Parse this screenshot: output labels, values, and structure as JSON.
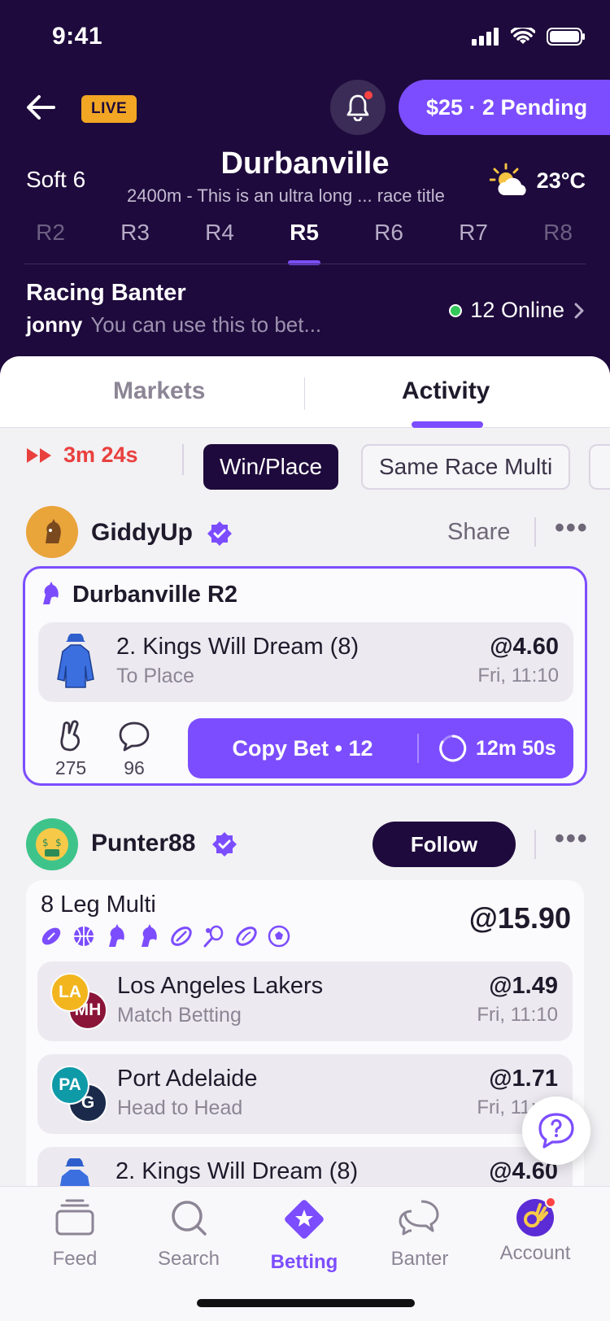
{
  "status_bar": {
    "time": "9:41"
  },
  "header": {
    "live_label": "LIVE",
    "pending_label": "$25 · 2 Pending",
    "going": "Soft 6",
    "venue": "Durbanville",
    "race_subtitle": "2400m - This is an ultra long ... race title",
    "temperature": "23°C",
    "weather_icon": "partly-cloudy-icon",
    "race_tabs": [
      "R2",
      "R3",
      "R4",
      "R5",
      "R6",
      "R7",
      "R8"
    ],
    "active_race": "R5"
  },
  "banter": {
    "title": "Racing Banter",
    "user": "jonny",
    "message": "You can use this to bet...",
    "online": "12 Online"
  },
  "segment": {
    "tabs": [
      "Markets",
      "Activity"
    ],
    "active": "Activity"
  },
  "filters": {
    "countdown": "3m 24s",
    "chips": [
      "Win/Place",
      "Same Race Multi"
    ],
    "active_chip": "Win/Place"
  },
  "post1": {
    "user": "GiddyUp",
    "avatar_icon": "horse-icon",
    "share_label": "Share",
    "race": "Durbanville R2",
    "runner": "2. Kings Will Dream (8)",
    "market": "To Place",
    "odds": "@4.60",
    "time": "Fri, 11:10",
    "reactions": {
      "fingers": "275",
      "comments": "96"
    },
    "copy_label": "Copy Bet",
    "copy_count": "12",
    "copy_timer": "12m 50s"
  },
  "post2": {
    "user": "Punter88",
    "avatar_icon": "money-face-icon",
    "follow_label": "Follow",
    "title": "8 Leg Multi",
    "total_odds": "@15.90",
    "sport_icons": [
      "football-icon",
      "basketball-icon",
      "horse-icon",
      "horse-icon",
      "rugby-icon",
      "tennis-icon",
      "afl-icon",
      "soccer-icon"
    ],
    "legs": [
      {
        "name": "Los Angeles Lakers",
        "market": "Match Betting",
        "odds": "@1.49",
        "time": "Fri, 11:10",
        "badge1": "LA",
        "badge2": "MH",
        "color1": "#f2b51e",
        "color2": "#8a1538"
      },
      {
        "name": "Port Adelaide",
        "market": "Head to Head",
        "odds": "@1.71",
        "time": "Fri, 11:10",
        "badge1": "PA",
        "badge2": "G",
        "color1": "#0f9aa8",
        "color2": "#1b2a4a"
      },
      {
        "name": "2. Kings Will Dream (8)",
        "odds": "@4.60"
      }
    ]
  },
  "nav": {
    "items": [
      "Feed",
      "Search",
      "Betting",
      "Banter",
      "Account"
    ],
    "active": "Betting"
  },
  "colors": {
    "brand": "#7c4dff",
    "header_bg": "#1e0a3c",
    "live": "#f2a623",
    "countdown": "#e9403e",
    "online": "#34c759"
  }
}
